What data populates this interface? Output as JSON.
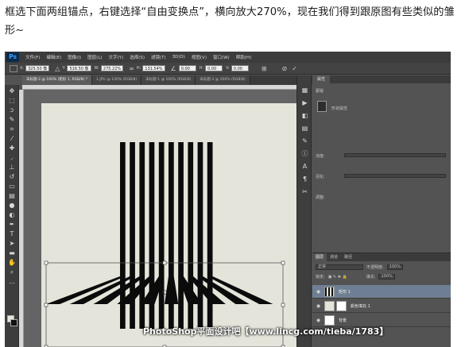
{
  "caption": "框选下面两组锚点，右键选择“自由变换点”，横向放大270%，现在我们得到跟原图有些类似的雏形~",
  "menu": {
    "logo": "Ps",
    "items": [
      "文件(F)",
      "编辑(E)",
      "图像(I)",
      "图层(L)",
      "文字(Y)",
      "选择(S)",
      "滤镜(T)",
      "3D(D)",
      "视图(V)",
      "窗口(W)",
      "帮助(H)"
    ]
  },
  "options": {
    "x_label": "X:",
    "x_value": "325.50 像",
    "y_label": "Y:",
    "y_value": "516.50 像",
    "w_label": "W:",
    "w_value": "275.22%",
    "h_label": "H:",
    "h_value": "131.54%",
    "angle_value": "0.00",
    "hskew_label": "H:",
    "hskew_value": "0.00",
    "vskew_label": "V:",
    "vskew_value": "0.00"
  },
  "tabs": [
    {
      "label": "未标题-2 @ 100% (矩形 1, RGB/8) *",
      "active": true
    },
    {
      "label": "1.JPG @ 100% (RGB/8)",
      "active": false
    },
    {
      "label": "未标题-1 @ 100% (RGB/8)",
      "active": false
    },
    {
      "label": "未标题-2 @ 200% (RGB/8)",
      "active": false
    }
  ],
  "properties": {
    "tab": "属性",
    "mask_label": "蒙版",
    "content_label": "形状属性",
    "density_label": "浓度:",
    "feather_label": "羽化:",
    "refine_label": "调整:"
  },
  "layers": {
    "tabs": [
      "图层",
      "通道",
      "路径"
    ],
    "mode": "正常",
    "opacity_label": "不透明度:",
    "opacity_value": "100%",
    "lock_label": "锁定:",
    "fill_label": "填充:",
    "fill_value": "100%",
    "rows": [
      {
        "name": "矩形 1",
        "selected": true
      },
      {
        "name": "颜色填充 1",
        "selected": false
      },
      {
        "name": "背景",
        "selected": false
      }
    ]
  },
  "canvas": {
    "background": "#e5e4da",
    "stripe_color": "#0b0b0b",
    "panel_gray": "#535353"
  },
  "watermark": "PhotoShop平面设计吧【www.lincg.com/tieba/1783】"
}
